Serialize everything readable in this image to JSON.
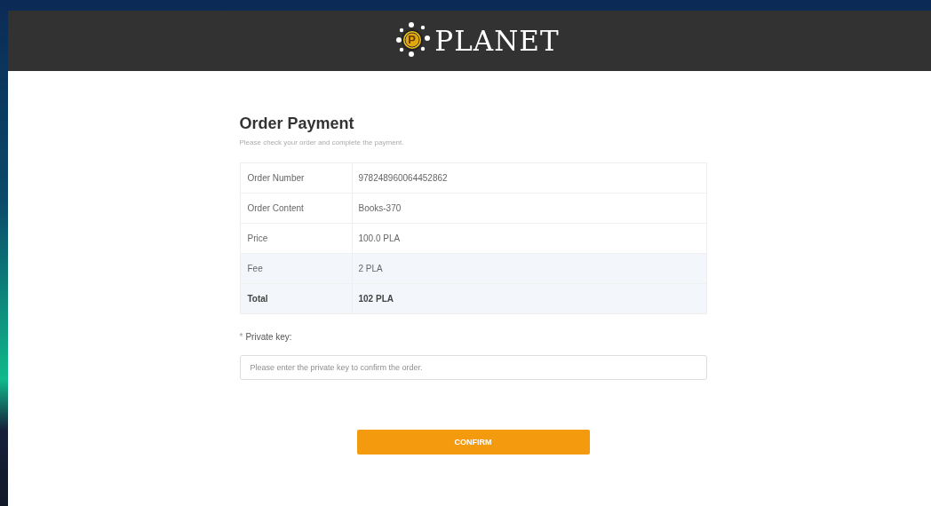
{
  "header": {
    "logo_mark": "P",
    "brand": "PLANET"
  },
  "title": "Order Payment",
  "subtitle": "Please check your order and complete the payment.",
  "rows": [
    {
      "label": "Order Number",
      "value": "978248960064452862",
      "kind": "item",
      "highlighted": false
    },
    {
      "label": "Order Content",
      "value": "Books-370",
      "kind": "item",
      "highlighted": false
    },
    {
      "label": "Price",
      "value": "100.0 PLA",
      "kind": "item",
      "highlighted": false
    },
    {
      "label": "Fee",
      "value": "2 PLA",
      "kind": "item",
      "highlighted": true
    },
    {
      "label": "Total",
      "value": "102 PLA",
      "kind": "total",
      "highlighted": true
    }
  ],
  "private_key": {
    "required_mark": "*",
    "label": "Private key:",
    "placeholder": "Please enter the private key to confirm the order."
  },
  "confirm_button": "CONFIRM"
}
